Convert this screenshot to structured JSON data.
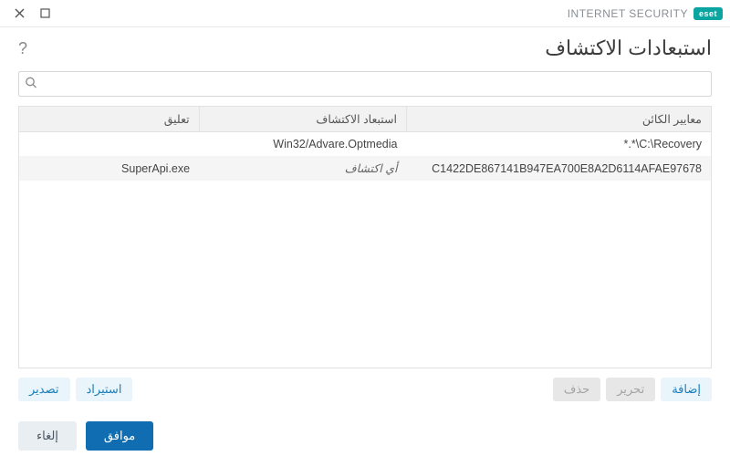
{
  "brand": {
    "logo": "eset",
    "product": "INTERNET SECURITY"
  },
  "header": {
    "title": "استبعادات الاكتشاف"
  },
  "search": {
    "placeholder": ""
  },
  "columns": {
    "criteria": "معايير الكائن",
    "exclusion": "استبعاد الاكتشاف",
    "comment": "تعليق"
  },
  "rows": [
    {
      "criteria": "*.*\\C:\\Recovery",
      "exclusion": "Win32/Advare.Optmedia",
      "comment": "",
      "exclusion_italic": false
    },
    {
      "criteria": "C1422DE867141B947EA700E8A2D6114AFAE97678",
      "exclusion": "أي اكتشاف",
      "comment": "SuperApi.exe",
      "exclusion_italic": true
    }
  ],
  "toolbar": {
    "add": "إضافة",
    "edit": "تحرير",
    "delete": "حذف",
    "import": "استيراد",
    "export": "تصدير"
  },
  "footer": {
    "ok": "موافق",
    "cancel": "إلغاء"
  }
}
